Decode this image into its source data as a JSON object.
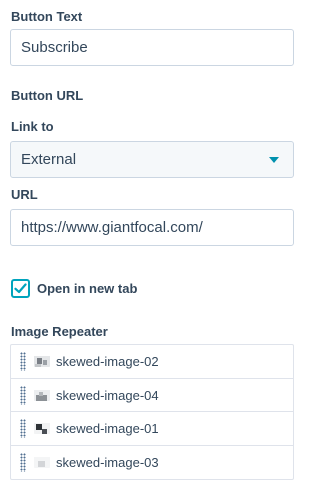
{
  "button_text": {
    "label": "Button Text",
    "value": "Subscribe"
  },
  "button_url": {
    "heading": "Button URL",
    "link_to_label": "Link to",
    "link_to_value": "External",
    "url_label": "URL",
    "url_value": "https://www.giantfocal.com/"
  },
  "open_new_tab": {
    "label": "Open in new tab",
    "checked": true
  },
  "image_repeater": {
    "label": "Image Repeater",
    "items": [
      {
        "name": "skewed-image-02"
      },
      {
        "name": "skewed-image-04"
      },
      {
        "name": "skewed-image-01"
      },
      {
        "name": "skewed-image-03"
      }
    ]
  },
  "colors": {
    "text": "#33475b",
    "border": "#cbd6e2",
    "accent": "#00a4bd",
    "caret": "#0091ae"
  }
}
